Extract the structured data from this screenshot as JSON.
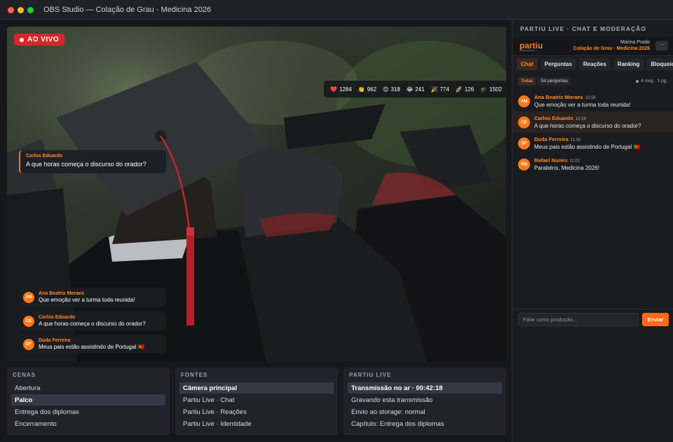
{
  "window": {
    "title": "OBS Studio — Colação de Grau · Medicina 2026"
  },
  "preview": {
    "live_badge": "AO VIVO",
    "reactions": [
      {
        "icon": "heart-icon",
        "emoji": "❤️",
        "count": "1284"
      },
      {
        "icon": "clap-icon",
        "emoji": "👏",
        "count": "962"
      },
      {
        "icon": "happy-face-icon",
        "emoji": "😊",
        "count": "318"
      },
      {
        "icon": "laugh-face-icon",
        "emoji": "😂",
        "count": "241"
      },
      {
        "icon": "party-popper-icon",
        "emoji": "🎉",
        "count": "774"
      },
      {
        "icon": "rocket-icon",
        "emoji": "🚀",
        "count": "126"
      },
      {
        "icon": "graduation-icon",
        "emoji": "🎓",
        "count": "1502"
      }
    ],
    "featured": {
      "name": "Carlos Eduardo",
      "text": "A que horas começa o discurso do orador?"
    },
    "overlay_messages": [
      {
        "initials": "AM",
        "name": "Ana Beatriz Moraes",
        "text": "Que emoção ver a turma toda reunida!"
      },
      {
        "initials": "CE",
        "name": "Carlos Eduardo",
        "text": "A que horas começa o discurso do orador?"
      },
      {
        "initials": "DF",
        "name": "Duda Ferreira",
        "text": "Meus pais estão assistindo de Portugal 🇵🇹"
      }
    ]
  },
  "docks": {
    "cenas": {
      "title": "CENAS",
      "items": [
        "Abertura",
        "Palco",
        "Entrega dos diplomas",
        "Encerramento"
      ],
      "selected": "Palco"
    },
    "fontes": {
      "title": "FONTES",
      "items": [
        "Câmera principal",
        "Partiu Live · Chat",
        "Partiu Live · Reações",
        "Partiu Live · Identidade"
      ],
      "selected": "Câmera principal"
    },
    "partiu": {
      "title": "PARTIU LIVE",
      "items": [
        "Transmissão no ar · 00:42:18",
        "Gravando esta transmissão",
        "Envio ao storage: normal",
        "Capítulo: Entrega dos diplomas"
      ],
      "selected": "Transmissão no ar · 00:42:18"
    }
  },
  "sidebar": {
    "header": "PARTIU LIVE · CHAT E MODERAÇÃO",
    "brand": "partiu",
    "brand_sub": "STREAMING",
    "user_name": "Marina Prado",
    "event": "Colação de Grau · Medicina 2026",
    "more": "···",
    "tabs": [
      "Chat",
      "Perguntas",
      "Reações",
      "Ranking",
      "Bloqueios"
    ],
    "active_tab": "Chat",
    "filters": [
      "Todas",
      "Só perguntas"
    ],
    "active_filter": "Todas",
    "count": "4 msg · 1 pg.",
    "messages": [
      {
        "initials": "AM",
        "name": "Ana Beatriz Moraes",
        "time": "10:56",
        "text": "Que emoção ver a turma toda reunida!"
      },
      {
        "initials": "CE",
        "name": "Carlos Eduardo",
        "time": "10:58",
        "text": "A que horas começa o discurso do orador?"
      },
      {
        "initials": "DF",
        "name": "Duda Ferreira",
        "time": "11:00",
        "text": "Meus pais estão assistindo de Portugal 🇵🇹"
      },
      {
        "initials": "RN",
        "name": "Rafael Nunes",
        "time": "11:02",
        "text": "Parabéns, Medicina 2026!"
      }
    ],
    "highlighted_message": 1,
    "input_placeholder": "Falar como produção...",
    "send_label": "Enviar"
  },
  "colors": {
    "accent": "#ff7a1a",
    "live": "#d9262a"
  }
}
